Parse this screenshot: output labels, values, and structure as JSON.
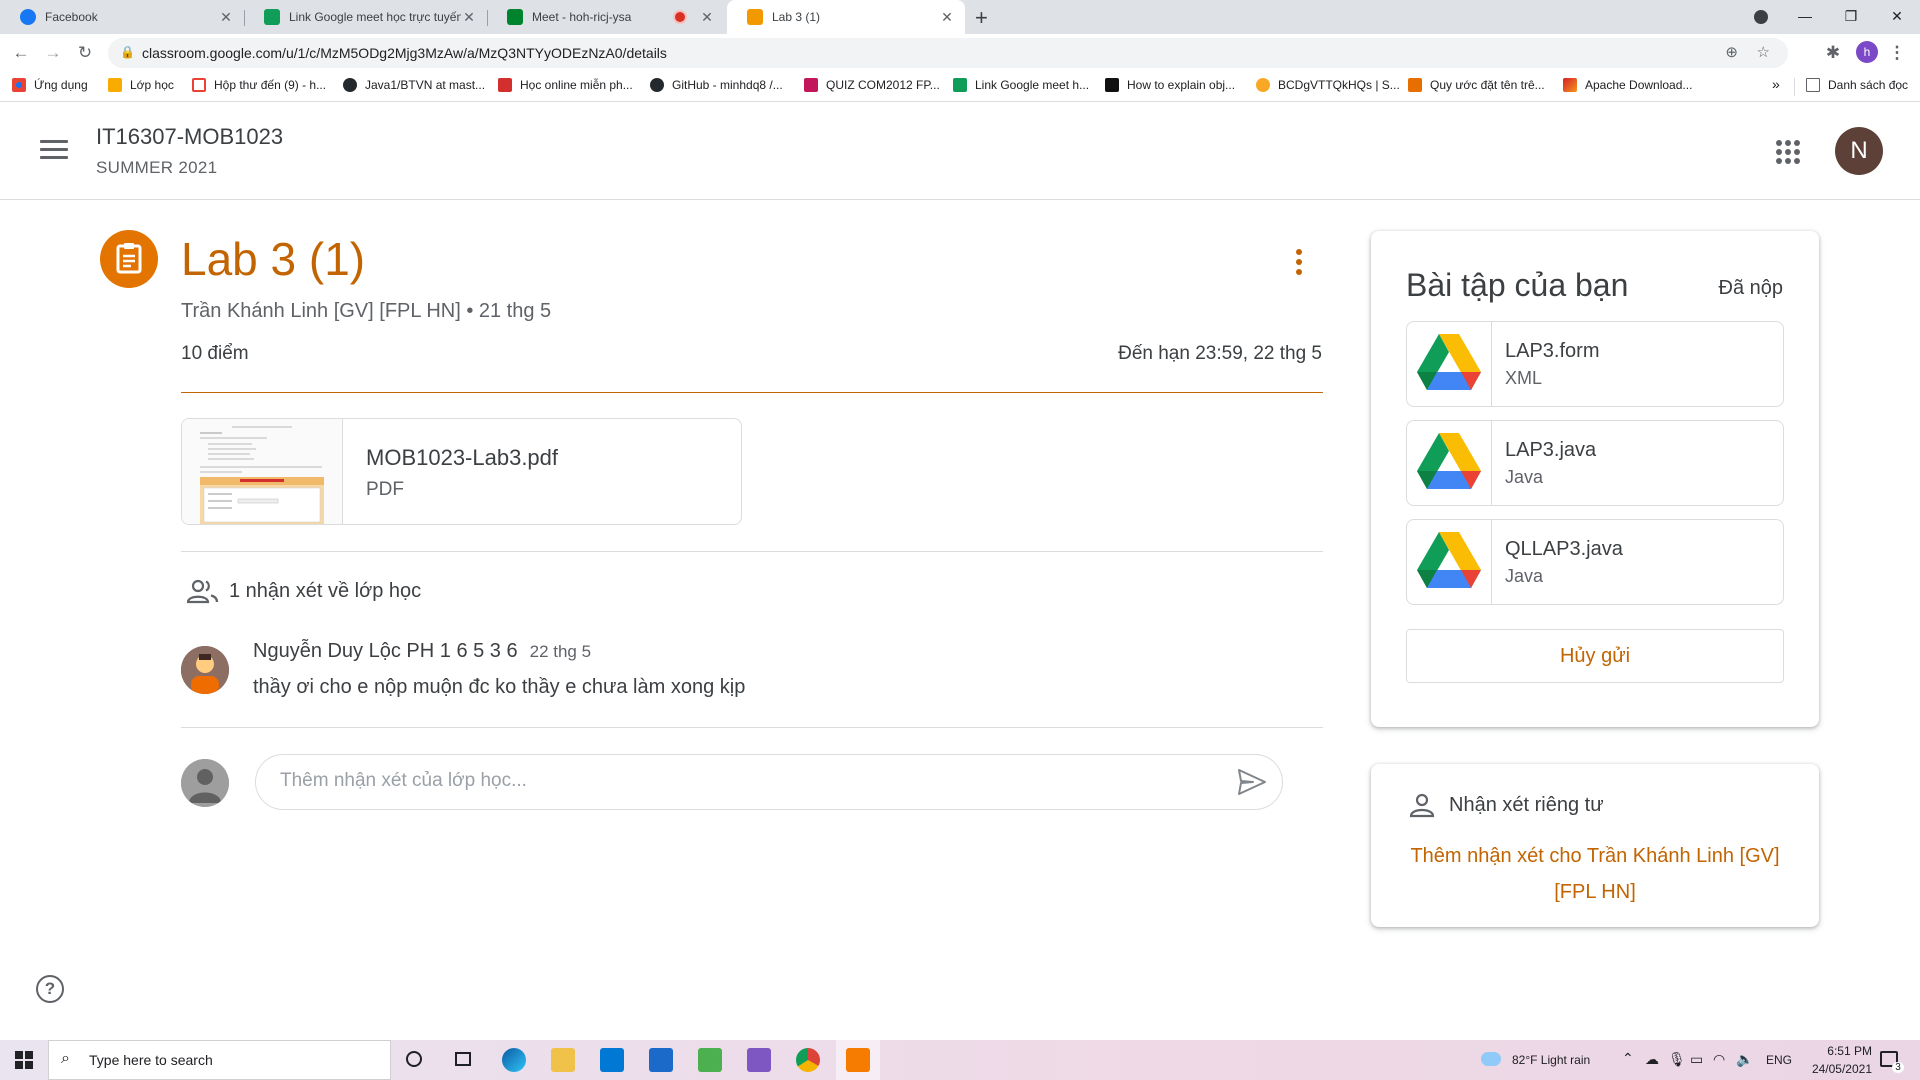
{
  "browser": {
    "tabs": [
      {
        "title": "Facebook",
        "favicon_color": "#1877f2",
        "active": false
      },
      {
        "title": "Link Google meet học trực tuyến",
        "favicon_color": "#0f9d58",
        "active": false
      },
      {
        "title": "Meet - hoh-ricj-ysa",
        "favicon_color": "#00832d",
        "active": false,
        "recording": true
      },
      {
        "title": "Lab 3 (1)",
        "favicon_color": "#f29900",
        "active": true
      }
    ],
    "url": "classroom.google.com/u/1/c/MzM5ODg2Mjg3MzAw/a/MzQ3NTYyODEzNzA0/details",
    "profile_initial": "h",
    "bookmarks": [
      {
        "label": "Ứng dụng",
        "icon": "apps-grid-icon"
      },
      {
        "label": "Lớp học",
        "icon": "classroom-icon"
      },
      {
        "label": "Hộp thư đến (9) - h...",
        "icon": "gmail-icon"
      },
      {
        "label": "Java1/BTVN at mast...",
        "icon": "github-icon"
      },
      {
        "label": "Học online miễn ph...",
        "icon": "flag-icon"
      },
      {
        "label": "GitHub - minhdq8 /...",
        "icon": "github-icon"
      },
      {
        "label": "QUIZ COM2012 FP...",
        "icon": "quiz-icon"
      },
      {
        "label": "Link Google meet h...",
        "icon": "sheets-icon"
      },
      {
        "label": "How to explain obj...",
        "icon": "medium-icon"
      },
      {
        "label": "BCDgVTTQkHQs | S...",
        "icon": "dollar-icon"
      },
      {
        "label": "Quy ước đặt tên trê...",
        "icon": "java-icon"
      },
      {
        "label": "Apache Download...",
        "icon": "apache-icon"
      }
    ],
    "bookmarks_more": "»",
    "reading_list": "Danh sách đọc"
  },
  "classroom": {
    "class_name": "IT16307-MOB1023",
    "class_section": "SUMMER 2021",
    "user_initial": "N",
    "accent_color": "#c26401"
  },
  "assignment": {
    "title": "Lab 3 (1)",
    "author_line": "Trần Khánh Linh [GV] [FPL HN] • 21 thg 5",
    "points": "10 điểm",
    "due": "Đến hạn 23:59, 22 thg 5",
    "attachment": {
      "name": "MOB1023-Lab3.pdf",
      "type": "PDF"
    }
  },
  "comments": {
    "header": "1 nhận xét về lớp học",
    "items": [
      {
        "author": "Nguyễn Duy Lộc PH 1 6 5 3 6",
        "date": "22 thg 5",
        "text": "thầy ơi cho e nộp muộn đc ko thầy e chưa làm xong kịp"
      }
    ],
    "input_placeholder": "Thêm nhận xét của lớp học..."
  },
  "your_work": {
    "title": "Bài tập của bạn",
    "status": "Đã nộp",
    "files": [
      {
        "name": "LAP3.form",
        "type": "XML"
      },
      {
        "name": "LAP3.java",
        "type": "Java"
      },
      {
        "name": "QLLAP3.java",
        "type": "Java"
      }
    ],
    "unsubmit_label": "Hủy gửi"
  },
  "private_comments": {
    "title": "Nhận xét riêng tư",
    "add_link": "Thêm nhận xét cho Trần Khánh Linh [GV] [FPL HN]"
  },
  "taskbar": {
    "search_placeholder": "Type here to search",
    "weather": "82°F  Light rain",
    "language": "ENG",
    "time": "6:51 PM",
    "date": "24/05/2021",
    "notification_count": "3"
  }
}
